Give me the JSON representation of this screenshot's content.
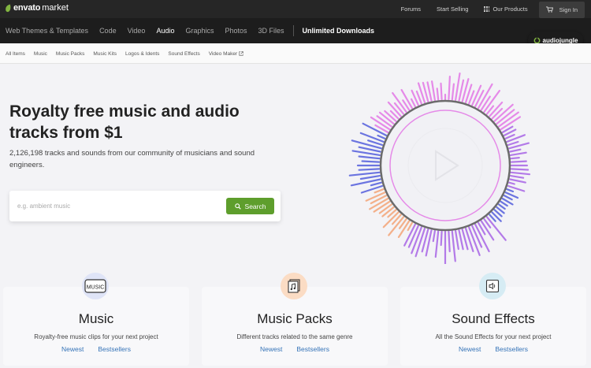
{
  "header": {
    "logo_brand": "envato",
    "logo_sub": "market",
    "links": [
      "Forums",
      "Start Selling"
    ],
    "our_products": "Our Products",
    "sign_in": "Sign In"
  },
  "nav": {
    "items": [
      "Web Themes & Templates",
      "Code",
      "Video",
      "Audio",
      "Graphics",
      "Photos",
      "3D Files"
    ],
    "active": "Audio",
    "unlimited": "Unlimited Downloads",
    "badge": "audiojungle"
  },
  "subnav": {
    "items": [
      "All Items",
      "Music",
      "Music Packs",
      "Music Kits",
      "Logos & Idents",
      "Sound Effects",
      "Video Maker"
    ]
  },
  "hero": {
    "title": "Royalty free music and audio tracks from $1",
    "subtitle": "2,126,198 tracks and sounds from our community of musicians and sound engineers.",
    "search_placeholder": "e.g. ambient music",
    "search_button": "Search"
  },
  "cards": [
    {
      "title": "Music",
      "desc": "Royalty-free music clips for your next project",
      "newest": "Newest",
      "bestsellers": "Bestsellers",
      "icon_text": "MUSIC",
      "icon_bg": "#dfe4f7",
      "icon_name": "music-tag-icon"
    },
    {
      "title": "Music Packs",
      "desc": "Different tracks related to the same genre",
      "newest": "Newest",
      "bestsellers": "Bestsellers",
      "icon_bg": "#fbdcc4",
      "icon_name": "music-pack-icon"
    },
    {
      "title": "Sound Effects",
      "desc": "All the Sound Effects for your next project",
      "newest": "Newest",
      "bestsellers": "Bestsellers",
      "icon_bg": "#d6ecf4",
      "icon_name": "speaker-icon"
    }
  ],
  "colors": {
    "accent_green": "#5e9e2c",
    "link_blue": "#3674b8",
    "wave_pink": "#e58ae8",
    "wave_blue": "#6b74e0",
    "wave_orange": "#f3b08a",
    "wave_purple": "#b37ae8"
  }
}
